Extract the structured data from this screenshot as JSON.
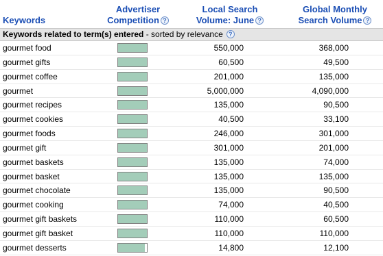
{
  "header": {
    "keywords": "Keywords",
    "competition_line1": "Advertiser",
    "competition_line2": "Competition",
    "local_line1": "Local Search",
    "local_line2": "Volume: June",
    "global_line1": "Global Monthly",
    "global_line2": "Search Volume",
    "help_glyph": "?"
  },
  "section": {
    "title": "Keywords related to term(s) entered",
    "subtitle": " - sorted by relevance"
  },
  "rows": [
    {
      "keyword": "gourmet food",
      "competition": 1.0,
      "local": "550,000",
      "global": "368,000"
    },
    {
      "keyword": "gourmet gifts",
      "competition": 1.0,
      "local": "60,500",
      "global": "49,500"
    },
    {
      "keyword": "gourmet coffee",
      "competition": 1.0,
      "local": "201,000",
      "global": "135,000"
    },
    {
      "keyword": "gourmet",
      "competition": 1.0,
      "local": "5,000,000",
      "global": "4,090,000"
    },
    {
      "keyword": "gourmet recipes",
      "competition": 1.0,
      "local": "135,000",
      "global": "90,500"
    },
    {
      "keyword": "gourmet cookies",
      "competition": 1.0,
      "local": "40,500",
      "global": "33,100"
    },
    {
      "keyword": "gourmet foods",
      "competition": 1.0,
      "local": "246,000",
      "global": "301,000"
    },
    {
      "keyword": "gourmet gift",
      "competition": 1.0,
      "local": "301,000",
      "global": "201,000"
    },
    {
      "keyword": "gourmet baskets",
      "competition": 1.0,
      "local": "135,000",
      "global": "74,000"
    },
    {
      "keyword": "gourmet basket",
      "competition": 1.0,
      "local": "135,000",
      "global": "135,000"
    },
    {
      "keyword": "gourmet chocolate",
      "competition": 1.0,
      "local": "135,000",
      "global": "90,500"
    },
    {
      "keyword": "gourmet cooking",
      "competition": 1.0,
      "local": "74,000",
      "global": "40,500"
    },
    {
      "keyword": "gourmet gift baskets",
      "competition": 1.0,
      "local": "110,000",
      "global": "60,500"
    },
    {
      "keyword": "gourmet gift basket",
      "competition": 1.0,
      "local": "110,000",
      "global": "110,000"
    },
    {
      "keyword": "gourmet desserts",
      "competition": 0.93,
      "local": "14,800",
      "global": "12,100"
    }
  ],
  "colors": {
    "header_text": "#1c4fb5",
    "bar_fill": "#a3cdb9",
    "section_bg": "#e5e5e5"
  }
}
